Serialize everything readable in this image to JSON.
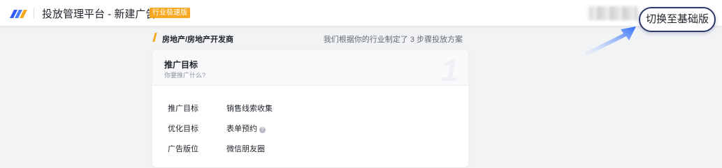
{
  "header": {
    "app_title": "投放管理平台 - 新建广告",
    "edition_badge": "行业极速版",
    "switch_button": "切换至基础版"
  },
  "industry": {
    "label": "房地产/房地产开发商",
    "plan_note": "我们根据你的行业制定了 3 步骤投放方案"
  },
  "card": {
    "title": "推广目标",
    "subtitle": "你要推广什么?",
    "step_number": "1",
    "fields": [
      {
        "label": "推广目标",
        "value": "销售线索收集"
      },
      {
        "label": "优化目标",
        "value": "表单预约",
        "help_icon": "question-circle-icon"
      },
      {
        "label": "广告版位",
        "value": "微信朋友圈"
      }
    ]
  },
  "colors": {
    "accent_orange": "#f7a821",
    "button_border": "#2d3a6b",
    "page_bg": "#f2f3f5"
  }
}
